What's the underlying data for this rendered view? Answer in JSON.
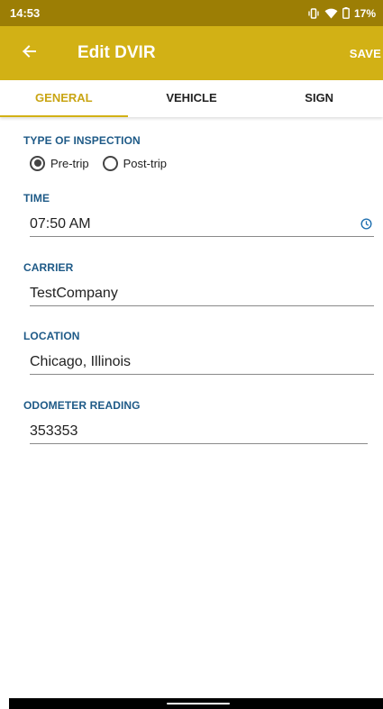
{
  "status_bar": {
    "time": "14:53",
    "battery": "17%",
    "icons": [
      "vibrate-icon",
      "wifi-icon",
      "battery-icon"
    ]
  },
  "app_bar": {
    "title": "Edit DVIR",
    "save_label": "SAVE",
    "back_icon": "arrow-back-icon"
  },
  "tabs": [
    {
      "label": "GENERAL",
      "active": true
    },
    {
      "label": "VEHICLE",
      "active": false
    },
    {
      "label": "SIGN",
      "active": false
    }
  ],
  "form": {
    "inspection_type": {
      "label": "TYPE OF INSPECTION",
      "options": [
        {
          "label": "Pre-trip",
          "checked": true
        },
        {
          "label": "Post-trip",
          "checked": false
        }
      ]
    },
    "time": {
      "label": "TIME",
      "value": "07:50 AM",
      "icon": "clock-icon"
    },
    "carrier": {
      "label": "CARRIER",
      "value": "TestCompany"
    },
    "location": {
      "label": "LOCATION",
      "value": "Chicago, Illinois"
    },
    "odometer": {
      "label": "ODOMETER READING",
      "value": "353353"
    }
  },
  "colors": {
    "status_bar": "#9c7e05",
    "app_bar": "#d2b115",
    "accent": "#c9a514",
    "section_label": "#1e5a87",
    "time_icon": "#1e6fb0"
  }
}
